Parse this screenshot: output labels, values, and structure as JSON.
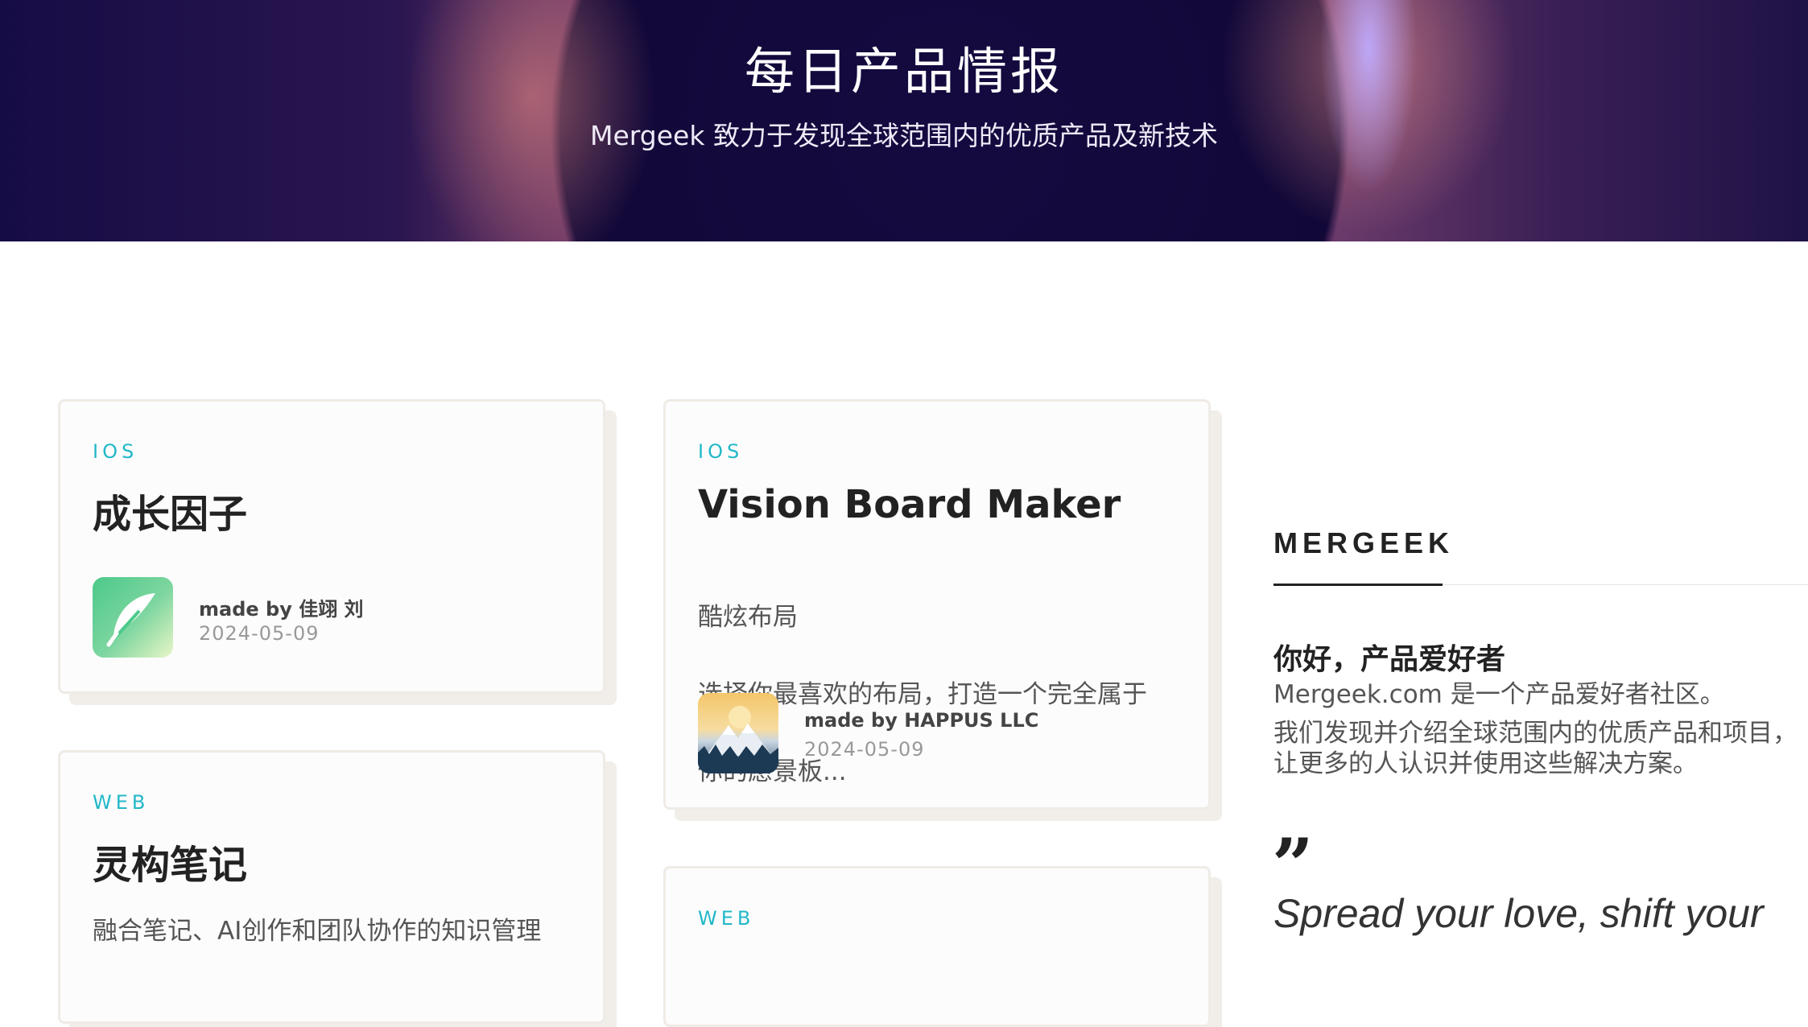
{
  "hero": {
    "title": "每日产品情报",
    "subtitle": "Mergeek 致力于发现全球范围内的优质产品及新技术"
  },
  "cards": [
    {
      "tag": "IOS",
      "title": "成长因子",
      "maker": "made by 佳翊 刘",
      "date": "2024-05-09",
      "icon": "feather-icon"
    },
    {
      "tag": "IOS",
      "title": "Vision Board Maker",
      "description_lines": [
        "酷炫布局",
        "选择你最喜欢的布局，打造一个完全属于",
        "你的愿景板..."
      ],
      "maker": "made by HAPPUS LLC",
      "date": "2024-05-09",
      "icon": "mountain-icon"
    },
    {
      "tag": "WEB",
      "title": "灵构笔记",
      "description": "融合笔记、AI创作和团队协作的知识管理"
    },
    {
      "tag": "WEB"
    }
  ],
  "sidebar": {
    "brand": "MERGEEK",
    "hello": "你好，产品爱好者",
    "p1": "Mergeek.com 是一个产品爱好者社区。",
    "p2": "我们发现并介绍全球范围内的优质产品和项目，",
    "p3": "让更多的人认识并使用这些解决方案。",
    "quote_icon": "quote-icon",
    "quote": "Spread your love, shift your"
  },
  "colors": {
    "tag": "#21b8c8",
    "card_border": "#efebe6",
    "hero_dark": "#140a40"
  }
}
